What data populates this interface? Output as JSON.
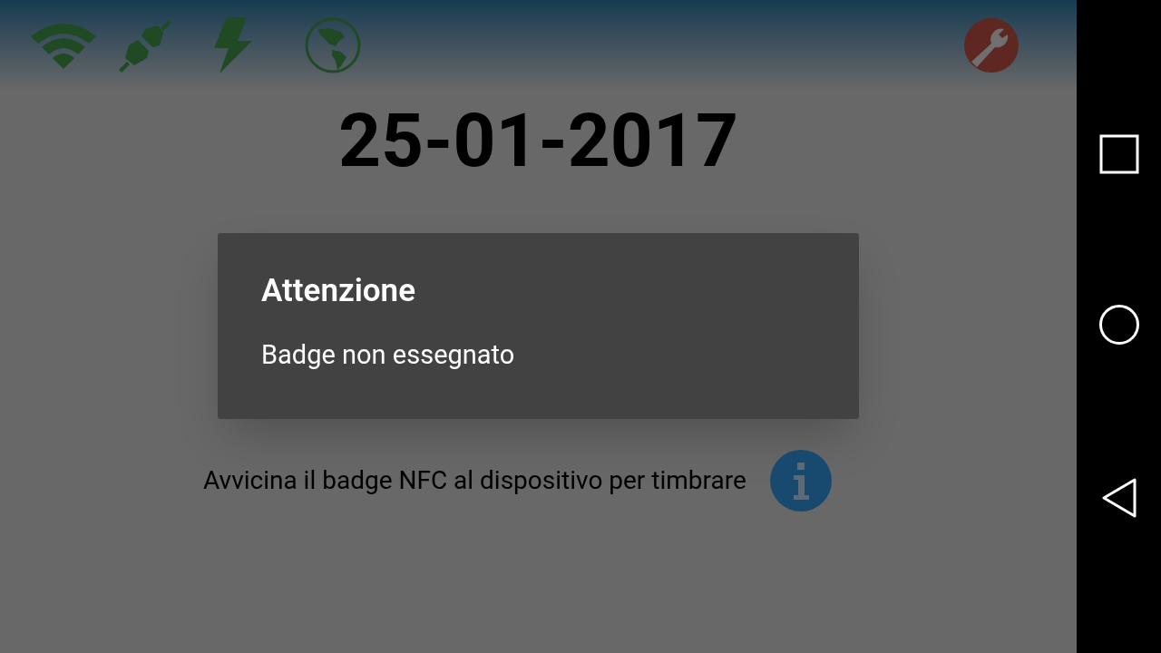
{
  "date": "25-01-2017",
  "dialog": {
    "title": "Attenzione",
    "message": "Badge non essegnato"
  },
  "instruction": "Avvicina il badge NFC al dispositivo per timbrare"
}
